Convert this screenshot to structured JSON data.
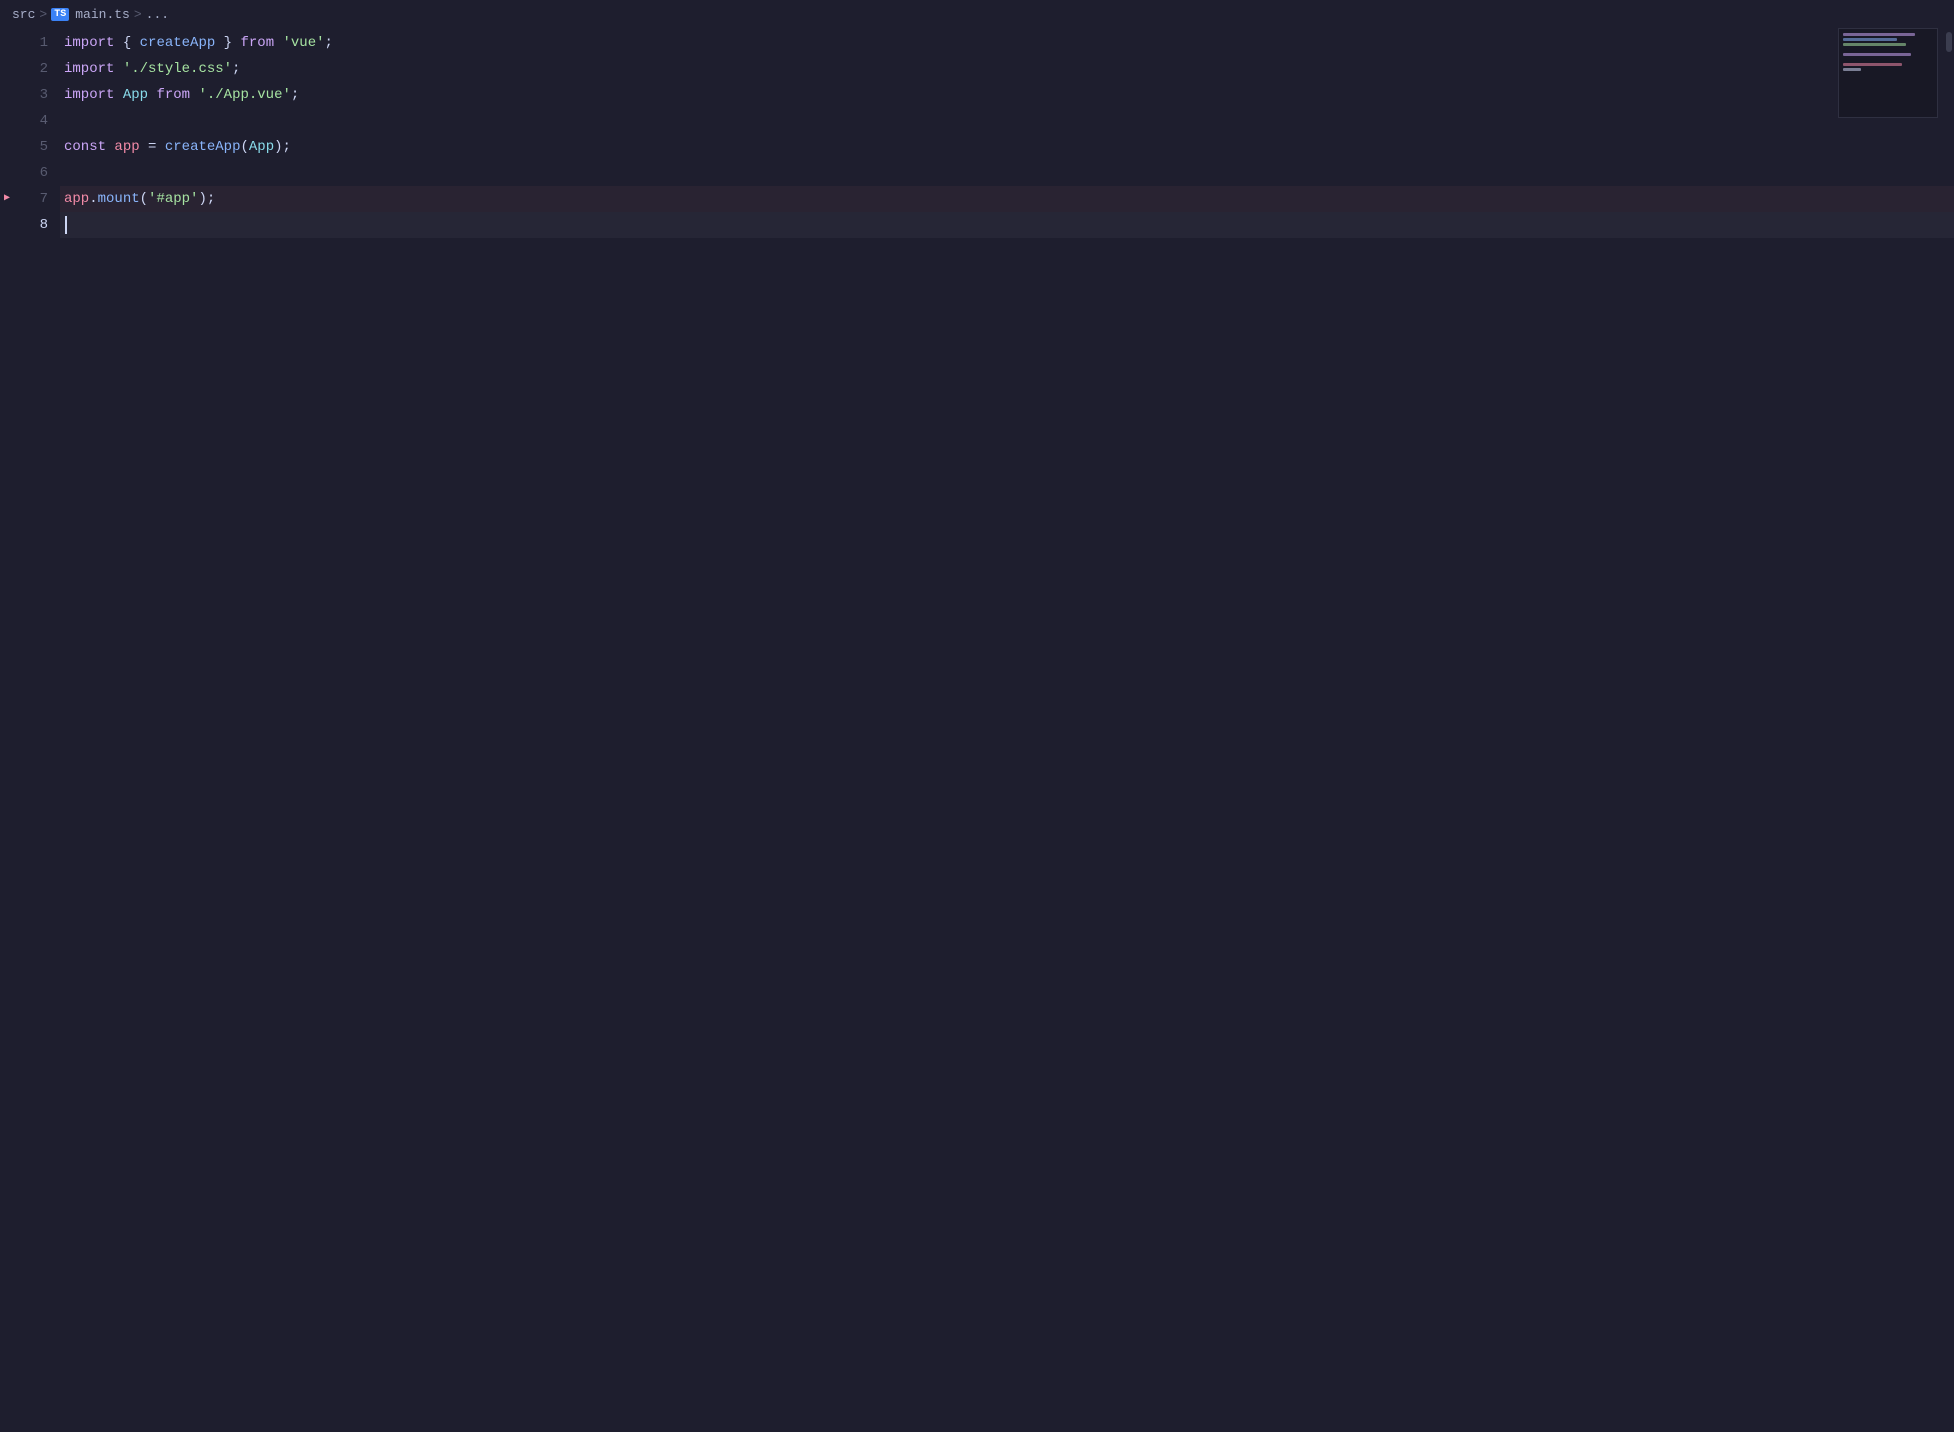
{
  "breadcrumb": {
    "src_label": "src",
    "separator1": ">",
    "ts_badge": "TS",
    "file_label": "main.ts",
    "separator2": ">",
    "ellipsis": "..."
  },
  "editor": {
    "lines": [
      {
        "number": 1,
        "tokens": [
          {
            "type": "kw",
            "text": "import"
          },
          {
            "type": "plain",
            "text": " { "
          },
          {
            "type": "fn",
            "text": "createApp"
          },
          {
            "type": "plain",
            "text": " } "
          },
          {
            "type": "kw",
            "text": "from"
          },
          {
            "type": "plain",
            "text": " "
          },
          {
            "type": "str",
            "text": "'vue'"
          },
          {
            "type": "plain",
            "text": ";"
          }
        ]
      },
      {
        "number": 2,
        "tokens": [
          {
            "type": "kw",
            "text": "import"
          },
          {
            "type": "plain",
            "text": " "
          },
          {
            "type": "str",
            "text": "'./style.css'"
          },
          {
            "type": "plain",
            "text": ";"
          }
        ]
      },
      {
        "number": 3,
        "tokens": [
          {
            "type": "kw",
            "text": "import"
          },
          {
            "type": "plain",
            "text": " "
          },
          {
            "type": "component",
            "text": "App"
          },
          {
            "type": "plain",
            "text": " "
          },
          {
            "type": "kw",
            "text": "from"
          },
          {
            "type": "plain",
            "text": " "
          },
          {
            "type": "str",
            "text": "'./App.vue'"
          },
          {
            "type": "plain",
            "text": ";"
          }
        ]
      },
      {
        "number": 4,
        "tokens": []
      },
      {
        "number": 5,
        "tokens": [
          {
            "type": "kw",
            "text": "const"
          },
          {
            "type": "plain",
            "text": " "
          },
          {
            "type": "app-var",
            "text": "app"
          },
          {
            "type": "plain",
            "text": " = "
          },
          {
            "type": "fn",
            "text": "createApp"
          },
          {
            "type": "plain",
            "text": "("
          },
          {
            "type": "component",
            "text": "App"
          },
          {
            "type": "plain",
            "text": ");"
          }
        ]
      },
      {
        "number": 6,
        "tokens": []
      },
      {
        "number": 7,
        "tokens": [
          {
            "type": "app-var",
            "text": "app"
          },
          {
            "type": "plain",
            "text": "."
          },
          {
            "type": "fn",
            "text": "mount"
          },
          {
            "type": "plain",
            "text": "("
          },
          {
            "type": "str",
            "text": "'#app'"
          },
          {
            "type": "plain",
            "text": ");"
          }
        ],
        "has_debug_arrow": true
      },
      {
        "number": 8,
        "tokens": [],
        "is_active": true,
        "show_cursor": true
      }
    ]
  },
  "minimap": {
    "lines": [
      {
        "width": "80%",
        "color": "#cba6f7"
      },
      {
        "width": "60%",
        "color": "#89b4fa"
      },
      {
        "width": "70%",
        "color": "#a6e3a1"
      },
      {
        "width": "0%",
        "color": "transparent"
      },
      {
        "width": "75%",
        "color": "#cba6f7"
      },
      {
        "width": "0%",
        "color": "transparent"
      },
      {
        "width": "65%",
        "color": "#f38ba8"
      },
      {
        "width": "20%",
        "color": "#cdd6f4"
      }
    ]
  }
}
